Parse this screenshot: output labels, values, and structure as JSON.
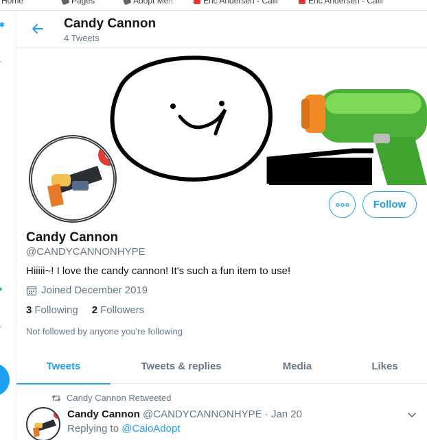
{
  "bookmarks": [
    {
      "label": "Home",
      "icon": "bookmark-icon"
    },
    {
      "label": "Pages",
      "icon": "bookmark-icon"
    },
    {
      "label": "Adopt Me!!",
      "icon": "bookmark-icon"
    },
    {
      "label": "Eric Andersen - Calli",
      "icon": "youtube-icon"
    },
    {
      "label": "Eric Andersen - Calli",
      "icon": "youtube-icon"
    }
  ],
  "header": {
    "title": "Candy Cannon",
    "subtitle": "4 Tweets"
  },
  "profile": {
    "name": "Candy Cannon",
    "handle": "@CANDYCANNONHYPE",
    "bio": "Hiiiii~! I love the candy cannon! It's such a fun item to use!",
    "joined": "Joined December 2019",
    "following_count": "3",
    "following_label": "Following",
    "followers_count": "2",
    "followers_label": "Followers",
    "not_followed": "Not followed by anyone you're following",
    "follow_label": "Follow"
  },
  "tabs": [
    {
      "label": "Tweets",
      "active": true
    },
    {
      "label": "Tweets & replies",
      "active": false
    },
    {
      "label": "Media",
      "active": false
    },
    {
      "label": "Likes",
      "active": false
    }
  ],
  "tweet": {
    "retweet_line": "Candy Cannon Retweeted",
    "author_name": "Candy Cannon",
    "author_handle": "@CANDYCANNONHYPE",
    "separator": " · ",
    "date": "Jan 20",
    "replying_prefix": "Replying to ",
    "replying_to": "@CaioAdopt"
  },
  "colors": {
    "accent": "#1da1f2",
    "muted": "#657786",
    "text": "#14171a"
  }
}
